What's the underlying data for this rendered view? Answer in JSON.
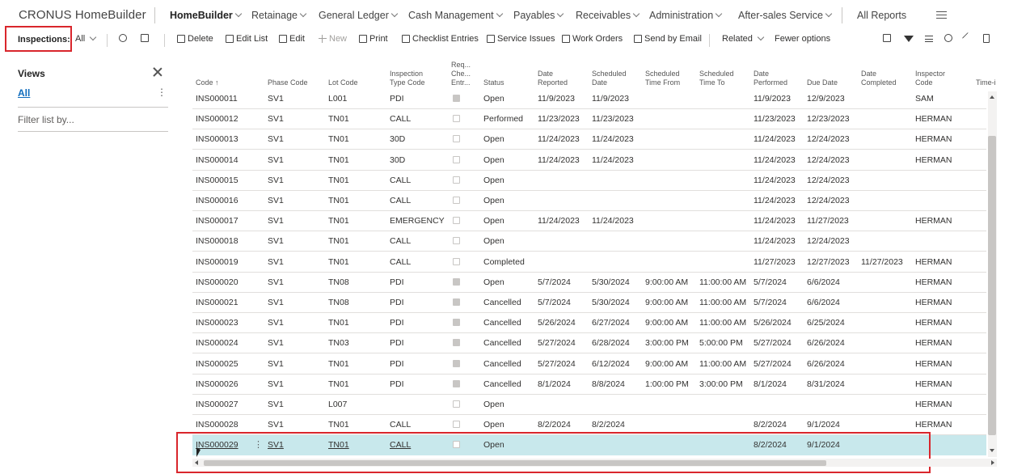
{
  "app": {
    "title": "CRONUS HomeBuilder"
  },
  "nav": {
    "items": [
      {
        "label": "HomeBuilder",
        "active": true
      },
      {
        "label": "Retainage"
      },
      {
        "label": "General Ledger"
      },
      {
        "label": "Cash Management"
      },
      {
        "label": "Payables"
      },
      {
        "label": "Receivables"
      },
      {
        "label": "Administration"
      },
      {
        "label": "After-sales Service"
      }
    ],
    "reports_label": "All Reports"
  },
  "actionbar": {
    "page_caption": "Inspections:",
    "filter_value": "All",
    "delete": "Delete",
    "edit_list": "Edit List",
    "edit": "Edit",
    "new": "New",
    "print": "Print",
    "checklist_entries": "Checklist Entries",
    "service_issues": "Service Issues",
    "work_orders": "Work Orders",
    "send_by_email": "Send by Email",
    "related": "Related",
    "fewer_options": "Fewer options"
  },
  "views": {
    "title": "Views",
    "all_label": "All",
    "filter_placeholder": "Filter list by..."
  },
  "table": {
    "columns": [
      {
        "key": "code",
        "label": "Code ↑"
      },
      {
        "key": "phase",
        "label": "Phase Code"
      },
      {
        "key": "lot",
        "label": "Lot Code"
      },
      {
        "key": "type",
        "label": "Inspection|Type Code"
      },
      {
        "key": "req",
        "label": "Req...|Che...|Entr..."
      },
      {
        "key": "status",
        "label": "Status"
      },
      {
        "key": "reported",
        "label": "Date|Reported"
      },
      {
        "key": "scheduled",
        "label": "Scheduled|Date"
      },
      {
        "key": "from",
        "label": "Scheduled|Time From"
      },
      {
        "key": "to",
        "label": "Scheduled|Time To"
      },
      {
        "key": "performed",
        "label": "Date|Performed"
      },
      {
        "key": "due",
        "label": "Due Date"
      },
      {
        "key": "completed",
        "label": "Date|Completed"
      },
      {
        "key": "inspector",
        "label": "Inspector|Code"
      },
      {
        "key": "timein",
        "label": "Time-i"
      }
    ],
    "rows": [
      {
        "code": "INS000011",
        "phase": "SV1",
        "lot": "L001",
        "type": "PDI",
        "req": true,
        "status": "Open",
        "reported": "11/9/2023",
        "scheduled": "11/9/2023",
        "from": "",
        "to": "",
        "performed": "11/9/2023",
        "due": "12/9/2023",
        "completed": "",
        "inspector": "SAM"
      },
      {
        "code": "INS000012",
        "phase": "SV1",
        "lot": "TN01",
        "type": "CALL",
        "req": false,
        "status": "Performed",
        "reported": "11/23/2023",
        "scheduled": "11/23/2023",
        "from": "",
        "to": "",
        "performed": "11/23/2023",
        "due": "12/23/2023",
        "completed": "",
        "inspector": "HERMAN"
      },
      {
        "code": "INS000013",
        "phase": "SV1",
        "lot": "TN01",
        "type": "30D",
        "req": false,
        "status": "Open",
        "reported": "11/24/2023",
        "scheduled": "11/24/2023",
        "from": "",
        "to": "",
        "performed": "11/24/2023",
        "due": "12/24/2023",
        "completed": "",
        "inspector": "HERMAN"
      },
      {
        "code": "INS000014",
        "phase": "SV1",
        "lot": "TN01",
        "type": "30D",
        "req": false,
        "status": "Open",
        "reported": "11/24/2023",
        "scheduled": "11/24/2023",
        "from": "",
        "to": "",
        "performed": "11/24/2023",
        "due": "12/24/2023",
        "completed": "",
        "inspector": "HERMAN"
      },
      {
        "code": "INS000015",
        "phase": "SV1",
        "lot": "TN01",
        "type": "CALL",
        "req": false,
        "status": "Open",
        "reported": "",
        "scheduled": "",
        "from": "",
        "to": "",
        "performed": "11/24/2023",
        "due": "12/24/2023",
        "completed": "",
        "inspector": ""
      },
      {
        "code": "INS000016",
        "phase": "SV1",
        "lot": "TN01",
        "type": "CALL",
        "req": false,
        "status": "Open",
        "reported": "",
        "scheduled": "",
        "from": "",
        "to": "",
        "performed": "11/24/2023",
        "due": "12/24/2023",
        "completed": "",
        "inspector": ""
      },
      {
        "code": "INS000017",
        "phase": "SV1",
        "lot": "TN01",
        "type": "EMERGENCY",
        "req": false,
        "status": "Open",
        "reported": "11/24/2023",
        "scheduled": "11/24/2023",
        "from": "",
        "to": "",
        "performed": "11/24/2023",
        "due": "11/27/2023",
        "completed": "",
        "inspector": "HERMAN"
      },
      {
        "code": "INS000018",
        "phase": "SV1",
        "lot": "TN01",
        "type": "CALL",
        "req": false,
        "status": "Open",
        "reported": "",
        "scheduled": "",
        "from": "",
        "to": "",
        "performed": "11/24/2023",
        "due": "12/24/2023",
        "completed": "",
        "inspector": ""
      },
      {
        "code": "INS000019",
        "phase": "SV1",
        "lot": "TN01",
        "type": "CALL",
        "req": false,
        "status": "Completed",
        "reported": "",
        "scheduled": "",
        "from": "",
        "to": "",
        "performed": "11/27/2023",
        "due": "12/27/2023",
        "completed": "11/27/2023",
        "inspector": "HERMAN"
      },
      {
        "code": "INS000020",
        "phase": "SV1",
        "lot": "TN08",
        "type": "PDI",
        "req": true,
        "status": "Open",
        "reported": "5/7/2024",
        "scheduled": "5/30/2024",
        "from": "9:00:00 AM",
        "to": "11:00:00 AM",
        "performed": "5/7/2024",
        "due": "6/6/2024",
        "completed": "",
        "inspector": "HERMAN"
      },
      {
        "code": "INS000021",
        "phase": "SV1",
        "lot": "TN08",
        "type": "PDI",
        "req": true,
        "status": "Cancelled",
        "reported": "5/7/2024",
        "scheduled": "5/30/2024",
        "from": "9:00:00 AM",
        "to": "11:00:00 AM",
        "performed": "5/7/2024",
        "due": "6/6/2024",
        "completed": "",
        "inspector": "HERMAN"
      },
      {
        "code": "INS000023",
        "phase": "SV1",
        "lot": "TN01",
        "type": "PDI",
        "req": true,
        "status": "Cancelled",
        "reported": "5/26/2024",
        "scheduled": "6/27/2024",
        "from": "9:00:00 AM",
        "to": "11:00:00 AM",
        "performed": "5/26/2024",
        "due": "6/25/2024",
        "completed": "",
        "inspector": "HERMAN"
      },
      {
        "code": "INS000024",
        "phase": "SV1",
        "lot": "TN03",
        "type": "PDI",
        "req": true,
        "status": "Cancelled",
        "reported": "5/27/2024",
        "scheduled": "6/28/2024",
        "from": "3:00:00 PM",
        "to": "5:00:00 PM",
        "performed": "5/27/2024",
        "due": "6/26/2024",
        "completed": "",
        "inspector": "HERMAN"
      },
      {
        "code": "INS000025",
        "phase": "SV1",
        "lot": "TN01",
        "type": "PDI",
        "req": true,
        "status": "Cancelled",
        "reported": "5/27/2024",
        "scheduled": "6/12/2024",
        "from": "9:00:00 AM",
        "to": "11:00:00 AM",
        "performed": "5/27/2024",
        "due": "6/26/2024",
        "completed": "",
        "inspector": "HERMAN"
      },
      {
        "code": "INS000026",
        "phase": "SV1",
        "lot": "TN01",
        "type": "PDI",
        "req": true,
        "status": "Cancelled",
        "reported": "8/1/2024",
        "scheduled": "8/8/2024",
        "from": "1:00:00 PM",
        "to": "3:00:00 PM",
        "performed": "8/1/2024",
        "due": "8/31/2024",
        "completed": "",
        "inspector": "HERMAN"
      },
      {
        "code": "INS000027",
        "phase": "SV1",
        "lot": "L007",
        "type": "",
        "req": false,
        "status": "Open",
        "reported": "",
        "scheduled": "",
        "from": "",
        "to": "",
        "performed": "",
        "due": "",
        "completed": "",
        "inspector": "HERMAN"
      },
      {
        "code": "INS000028",
        "phase": "SV1",
        "lot": "TN01",
        "type": "CALL",
        "req": false,
        "status": "Open",
        "reported": "8/2/2024",
        "scheduled": "8/2/2024",
        "from": "",
        "to": "",
        "performed": "8/2/2024",
        "due": "9/1/2024",
        "completed": "",
        "inspector": "HERMAN"
      },
      {
        "code": "INS000029",
        "phase": "SV1",
        "lot": "TN01",
        "type": "CALL",
        "req": false,
        "status": "Open",
        "reported": "",
        "scheduled": "",
        "from": "",
        "to": "",
        "performed": "8/2/2024",
        "due": "9/1/2024",
        "completed": "",
        "inspector": "",
        "selected": true
      }
    ]
  },
  "colors": {
    "accent": "#0f6cbd",
    "selection": "#c8e8ec",
    "highlight": "#d9262c"
  }
}
